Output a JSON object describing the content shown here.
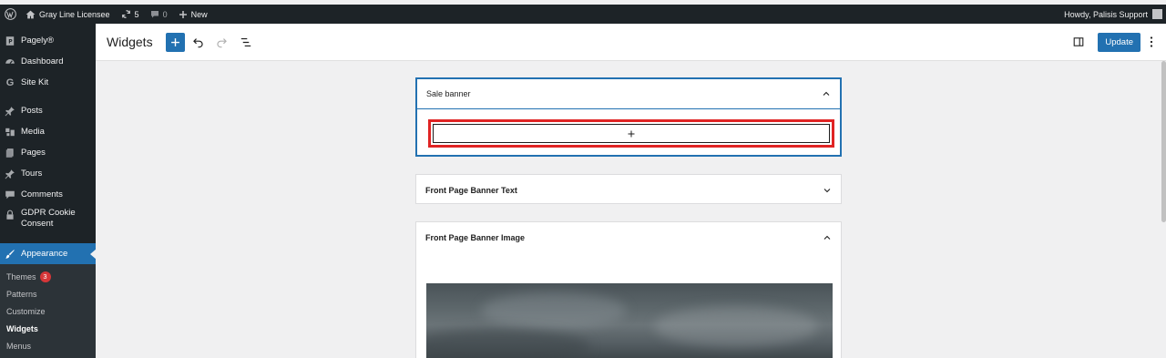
{
  "adminbar": {
    "site_name": "Gray Line Licensee",
    "updates_count": "5",
    "comments_count": "0",
    "new_label": "New",
    "greeting": "Howdy, Palisis Support"
  },
  "sidebar": {
    "items": [
      {
        "label": "Pagely®",
        "icon": "pagely-icon"
      },
      {
        "label": "Dashboard",
        "icon": "dashboard-icon"
      },
      {
        "label": "Site Kit",
        "icon": "google-icon"
      },
      {
        "label": "Posts",
        "icon": "pin-icon"
      },
      {
        "label": "Media",
        "icon": "media-icon"
      },
      {
        "label": "Pages",
        "icon": "pages-icon"
      },
      {
        "label": "Tours",
        "icon": "pin-icon"
      },
      {
        "label": "Comments",
        "icon": "comment-icon"
      },
      {
        "label": "GDPR Cookie Consent",
        "icon": "lock-icon"
      },
      {
        "label": "Appearance",
        "icon": "brush-icon"
      }
    ],
    "submenu": [
      {
        "label": "Themes",
        "badge": "3"
      },
      {
        "label": "Patterns"
      },
      {
        "label": "Customize"
      },
      {
        "label": "Widgets"
      },
      {
        "label": "Menus"
      }
    ]
  },
  "header": {
    "title": "Widgets",
    "update_label": "Update"
  },
  "widget_areas": [
    {
      "title": "Sale banner",
      "expanded": true
    },
    {
      "title": "Front Page Banner Text",
      "expanded": false
    },
    {
      "title": "Front Page Banner Image",
      "expanded": true
    }
  ],
  "colors": {
    "accent": "#2271b1",
    "sidebar": "#1d2327",
    "highlight": "#e02424"
  }
}
